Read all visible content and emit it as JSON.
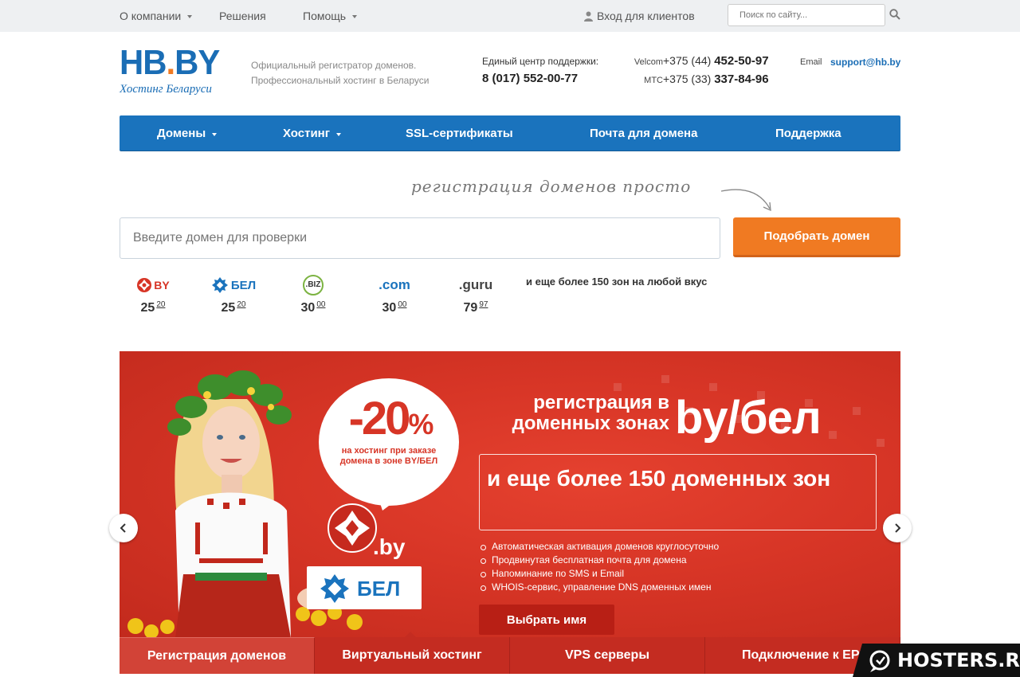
{
  "topbar": {
    "nav": [
      {
        "label": "О компании",
        "dropdown": true
      },
      {
        "label": "Решения",
        "dropdown": false
      },
      {
        "label": "Помощь",
        "dropdown": true
      }
    ],
    "login_label": "Вход для клиентов",
    "search_placeholder": "Поиск по сайту..."
  },
  "header": {
    "logo_left": "HB",
    "logo_dot": ".",
    "logo_right": "BY",
    "logo_sub": "Хостинг Беларуси",
    "tagline_line1": "Официальный регистратор доменов.",
    "tagline_line2": "Профессиональный хостинг в Беларуси",
    "support_label": "Единый центр поддержки:",
    "support_phone": "8 (017) 552-00-77",
    "phones": [
      {
        "operator": "Velcom",
        "prefix": "+375 (44) ",
        "number": "452-50-97"
      },
      {
        "operator": "МТС",
        "prefix": "+375 (33) ",
        "number": "337-84-96"
      }
    ],
    "email_label": "Email",
    "email": "support@hb.by"
  },
  "mainnav": [
    {
      "label": "Домены",
      "dropdown": true
    },
    {
      "label": "Хостинг",
      "dropdown": true
    },
    {
      "label": "SSL-сертификаты",
      "dropdown": false
    },
    {
      "label": "Почта для домена",
      "dropdown": false
    },
    {
      "label": "Поддержка",
      "dropdown": false
    }
  ],
  "slogan": "регистрация доменов просто",
  "domain_search": {
    "placeholder": "Введите домен для проверки",
    "button": "Подобрать домен"
  },
  "zones": [
    {
      "name": "BY",
      "price": "25",
      "cents": "20"
    },
    {
      "name": "БЕЛ",
      "price": "25",
      "cents": "20"
    },
    {
      "name": ".BIZ",
      "price": "30",
      "cents": "00"
    },
    {
      "name": ".com",
      "price": "30",
      "cents": "00"
    },
    {
      "name": ".guru",
      "price": "79",
      "cents": "97"
    }
  ],
  "zones_more": "и еще более 150 зон на любой вкус",
  "banner": {
    "discount": "-20",
    "discount_pct": "%",
    "discount_note": "на  хостинг при заказе домена в зоне BY/БЕЛ",
    "by_label": ".by",
    "bel_label": "БЕЛ",
    "title_small": "регистрация в доменных зонах",
    "title_big": "by/бел",
    "box_text": "и еще более 150 доменных зон",
    "features": [
      "Автоматическая активация доменов круглосуточно",
      "Продвинутая бесплатная почта для домена",
      "Напоминание по SMS и Email",
      "WHOIS-сервис, управление DNS доменных имен"
    ],
    "button": "Выбрать имя"
  },
  "tabs": [
    {
      "label": "Регистрация доменов",
      "active": true
    },
    {
      "label": "Виртуальный хостинг",
      "active": false
    },
    {
      "label": "VPS серверы",
      "active": false
    },
    {
      "label": "Подключение к EPI",
      "active": false
    }
  ],
  "watermark": "HOSTERS.RU",
  "colors": {
    "brand_blue": "#1a73bd",
    "accent_orange": "#f07a22",
    "banner_red": "#d73526"
  }
}
